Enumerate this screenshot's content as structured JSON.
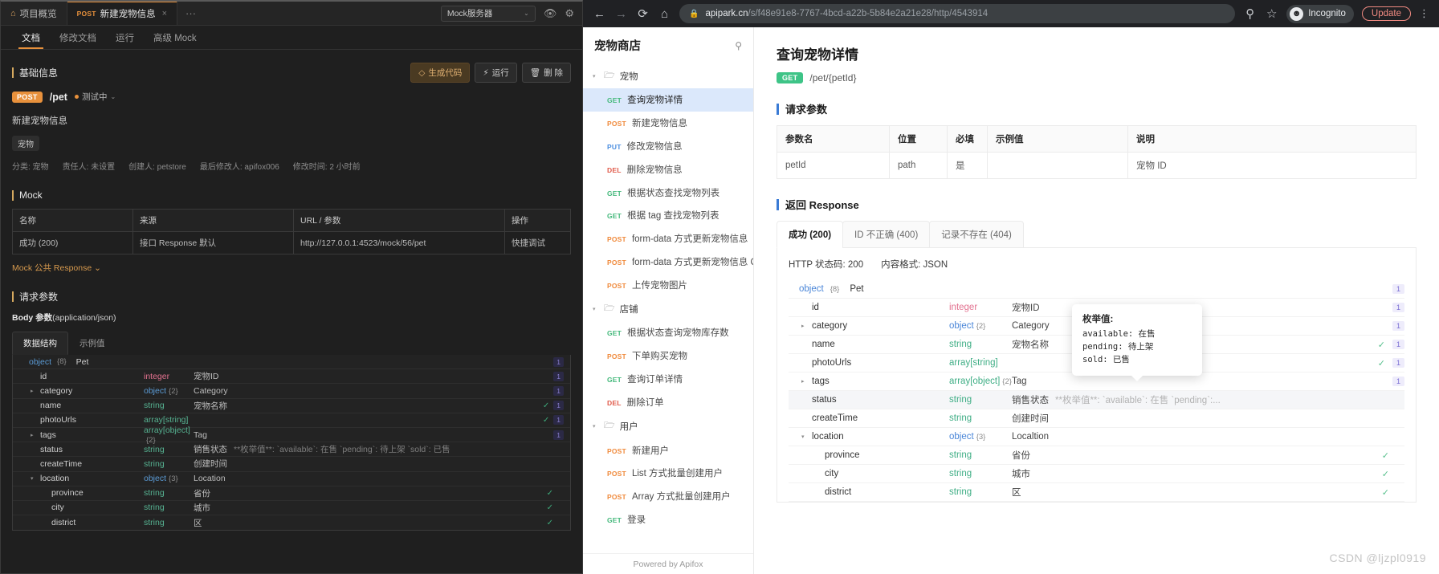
{
  "app": {
    "tabs": [
      {
        "icon": "project-icon",
        "label": "项目概览",
        "method": "",
        "active": false
      },
      {
        "icon": "",
        "label": "新建宠物信息",
        "method": "POST",
        "active": true,
        "close": "×"
      }
    ],
    "more": "···",
    "mock_server": {
      "label": "Mock服务器",
      "chevron": "⌄"
    },
    "header_icons": [
      "eye-icon",
      "gear-icon"
    ],
    "sub_tabs": [
      {
        "label": "文档",
        "active": true
      },
      {
        "label": "修改文档",
        "active": false
      },
      {
        "label": "运行",
        "active": false
      },
      {
        "label": "高级 Mock",
        "active": false
      }
    ],
    "basic": {
      "section": "基础信息",
      "actions": [
        {
          "label": "生成代码",
          "icon": "code-icon",
          "style": "gen"
        },
        {
          "label": "运行",
          "icon": "run-icon",
          "style": "run"
        },
        {
          "label": "删 除",
          "icon": "trash-icon",
          "style": "del"
        }
      ],
      "method": "POST",
      "path": "/pet",
      "status": "测试中",
      "status_chevron": "⌄",
      "api_name": "新建宠物信息",
      "tag": "宠物",
      "meta": [
        "分类: 宠物",
        "责任人: 未设置",
        "创建人: petstore",
        "最后修改人: apifox006",
        "修改时间: 2 小时前"
      ]
    },
    "mock": {
      "section": "Mock",
      "columns": [
        "名称",
        "来源",
        "URL / 参数",
        "操作"
      ],
      "rows": [
        {
          "name": "成功 (200)",
          "source": "接口 Response 默认",
          "url": "http://127.0.0.1:4523/mock/56/pet",
          "action": "快捷调试"
        }
      ],
      "public_link": "Mock 公共 Response ⌄"
    },
    "request": {
      "section": "请求参数",
      "body_label": "Body 参数",
      "body_type": "(application/json)",
      "tabs": [
        {
          "label": "数据结构",
          "active": true
        },
        {
          "label": "示例值",
          "active": false
        }
      ],
      "schema": [
        {
          "indent": 0,
          "arrow": "",
          "name": "object",
          "is_type_name": true,
          "count": "{8}",
          "type": "",
          "ref": "Pet",
          "desc": "",
          "check": false,
          "idx": "1"
        },
        {
          "indent": 1,
          "arrow": "",
          "name": "id",
          "type": "integer",
          "tclass": "t-int",
          "count": "",
          "desc": "宠物ID",
          "check": false,
          "idx": "1"
        },
        {
          "indent": 1,
          "arrow": "▸",
          "name": "category",
          "type": "object",
          "tclass": "t-obj",
          "count": "{2}",
          "desc": "Category",
          "check": false,
          "idx": "1"
        },
        {
          "indent": 1,
          "arrow": "",
          "name": "name",
          "type": "string",
          "tclass": "t-str",
          "count": "",
          "desc": "宠物名称",
          "check": true,
          "idx": "1"
        },
        {
          "indent": 1,
          "arrow": "",
          "name": "photoUrls",
          "type": "array[string]",
          "tclass": "t-str",
          "count": "",
          "desc": "",
          "check": true,
          "idx": "1"
        },
        {
          "indent": 1,
          "arrow": "▸",
          "name": "tags",
          "type": "array[object]",
          "tclass": "t-str",
          "count": "{2}",
          "desc": "Tag",
          "check": false,
          "idx": "1"
        },
        {
          "indent": 1,
          "arrow": "",
          "name": "status",
          "type": "string",
          "tclass": "t-str",
          "count": "",
          "desc": "销售状态",
          "enum": "**枚举值**: `available`: 在售 `pending`: 待上架 `sold`: 已售",
          "check": false,
          "idx": ""
        },
        {
          "indent": 1,
          "arrow": "",
          "name": "createTime",
          "type": "string",
          "tclass": "t-str",
          "count": "",
          "desc": "创建时间",
          "check": false,
          "idx": ""
        },
        {
          "indent": 1,
          "arrow": "▾",
          "name": "location",
          "type": "object",
          "tclass": "t-obj",
          "count": "{3}",
          "desc": "Location",
          "check": false,
          "idx": ""
        },
        {
          "indent": 2,
          "arrow": "",
          "name": "province",
          "type": "string",
          "tclass": "t-str",
          "count": "",
          "desc": "省份",
          "check": true,
          "idx": ""
        },
        {
          "indent": 2,
          "arrow": "",
          "name": "city",
          "type": "string",
          "tclass": "t-str",
          "count": "",
          "desc": "城市",
          "check": true,
          "idx": ""
        },
        {
          "indent": 2,
          "arrow": "",
          "name": "district",
          "type": "string",
          "tclass": "t-str",
          "count": "",
          "desc": "区",
          "check": true,
          "idx": ""
        }
      ]
    }
  },
  "browser": {
    "back": "←",
    "forward": "→",
    "reload": "⟳",
    "home": "⌂",
    "lock": "🔒",
    "url_host": "apipark.cn",
    "url_path": "/s/f48e91e8-7767-4bcd-a22b-5b84e2a21e28/http/4543914",
    "zoom_icon": "search-icon",
    "star": "☆",
    "incognito": "Incognito",
    "update": "Update",
    "kebab": "⋮"
  },
  "web": {
    "sidebar": {
      "title": "宠物商店",
      "search_icon": "search-icon",
      "footer": "Powered by Apifox",
      "items": [
        {
          "kind": "group",
          "label": "宠物",
          "caret": "▾"
        },
        {
          "kind": "api",
          "method": "GET",
          "mclass": "m-get",
          "label": "查询宠物详情",
          "selected": true
        },
        {
          "kind": "api",
          "method": "POST",
          "mclass": "m-post",
          "label": "新建宠物信息",
          "selected": false
        },
        {
          "kind": "api",
          "method": "PUT",
          "mclass": "m-put",
          "label": "修改宠物信息",
          "selected": false
        },
        {
          "kind": "api",
          "method": "DEL",
          "mclass": "m-del",
          "label": "删除宠物信息",
          "selected": false
        },
        {
          "kind": "api",
          "method": "GET",
          "mclass": "m-get",
          "label": "根据状态查找宠物列表",
          "selected": false
        },
        {
          "kind": "api",
          "method": "GET",
          "mclass": "m-get",
          "label": "根据 tag 查找宠物列表",
          "selected": false
        },
        {
          "kind": "api",
          "method": "POST",
          "mclass": "m-post",
          "label": "form-data 方式更新宠物信息",
          "selected": false
        },
        {
          "kind": "api",
          "method": "POST",
          "mclass": "m-post",
          "label": "form-data 方式更新宠物信息 Co",
          "selected": false
        },
        {
          "kind": "api",
          "method": "POST",
          "mclass": "m-post",
          "label": "上传宠物图片",
          "selected": false
        },
        {
          "kind": "group",
          "label": "店铺",
          "caret": "▾"
        },
        {
          "kind": "api",
          "method": "GET",
          "mclass": "m-get",
          "label": "根据状态查询宠物库存数",
          "selected": false
        },
        {
          "kind": "api",
          "method": "POST",
          "mclass": "m-post",
          "label": "下单购买宠物",
          "selected": false
        },
        {
          "kind": "api",
          "method": "GET",
          "mclass": "m-get",
          "label": "查询订单详情",
          "selected": false
        },
        {
          "kind": "api",
          "method": "DEL",
          "mclass": "m-del",
          "label": "删除订单",
          "selected": false
        },
        {
          "kind": "group",
          "label": "用户",
          "caret": "▾"
        },
        {
          "kind": "api",
          "method": "POST",
          "mclass": "m-post",
          "label": "新建用户",
          "selected": false
        },
        {
          "kind": "api",
          "method": "POST",
          "mclass": "m-post",
          "label": "List 方式批量创建用户",
          "selected": false
        },
        {
          "kind": "api",
          "method": "POST",
          "mclass": "m-post",
          "label": "Array 方式批量创建用户",
          "selected": false
        },
        {
          "kind": "api",
          "method": "GET",
          "mclass": "m-get",
          "label": "登录",
          "selected": false
        }
      ]
    },
    "doc": {
      "title": "查询宠物详情",
      "method": "GET",
      "path": "/pet/{petId}",
      "request_section": "请求参数",
      "param_columns": [
        "参数名",
        "位置",
        "必填",
        "示例值",
        "说明"
      ],
      "param_rows": [
        {
          "name": "petId",
          "in": "path",
          "required": "是",
          "example": "",
          "desc": "宠物 ID"
        }
      ],
      "response_section": "返回 Response",
      "resp_tabs": [
        {
          "label": "成功 (200)",
          "active": true
        },
        {
          "label": "ID 不正确 (400)",
          "active": false
        },
        {
          "label": "记录不存在 (404)",
          "active": false
        }
      ],
      "http_status": "HTTP 状态码: 200",
      "content_type": "内容格式: JSON",
      "schema": [
        {
          "indent": 0,
          "arrow": "",
          "name": "object",
          "is_type_name": true,
          "count": "{8}",
          "type": "",
          "ref": "Pet",
          "desc": "",
          "check": false,
          "idx": "1"
        },
        {
          "indent": 1,
          "arrow": "",
          "name": "id",
          "type": "integer",
          "tclass": "w-int",
          "count": "",
          "desc": "宠物ID",
          "check": false,
          "idx": "1"
        },
        {
          "indent": 1,
          "arrow": "▸",
          "name": "category",
          "type": "object",
          "tclass": "w-obj",
          "count": "{2}",
          "desc": "Category",
          "check": false,
          "idx": "1"
        },
        {
          "indent": 1,
          "arrow": "",
          "name": "name",
          "type": "string",
          "tclass": "w-str",
          "count": "",
          "desc": "宠物名称",
          "check": true,
          "idx": "1"
        },
        {
          "indent": 1,
          "arrow": "",
          "name": "photoUrls",
          "type": "array[string]",
          "tclass": "w-str",
          "count": "",
          "desc": "",
          "check": true,
          "idx": "1"
        },
        {
          "indent": 1,
          "arrow": "▸",
          "name": "tags",
          "type": "array[object]",
          "tclass": "w-str",
          "count": "{2}",
          "desc": "Tag",
          "check": false,
          "idx": "1"
        },
        {
          "indent": 1,
          "arrow": "",
          "name": "status",
          "type": "string",
          "tclass": "w-str",
          "count": "",
          "desc": "销售状态",
          "enum": "**枚举值**: `available`: 在售 `pending`:...",
          "check": false,
          "idx": "",
          "highlight": true
        },
        {
          "indent": 1,
          "arrow": "",
          "name": "createTime",
          "type": "string",
          "tclass": "w-str",
          "count": "",
          "desc": "创建时间",
          "check": false,
          "idx": ""
        },
        {
          "indent": 1,
          "arrow": "▾",
          "name": "location",
          "type": "object",
          "tclass": "w-obj",
          "count": "{3}",
          "desc": "Localtion",
          "check": false,
          "idx": ""
        },
        {
          "indent": 2,
          "arrow": "",
          "name": "province",
          "type": "string",
          "tclass": "w-str",
          "count": "",
          "desc": "省份",
          "check": true,
          "idx": ""
        },
        {
          "indent": 2,
          "arrow": "",
          "name": "city",
          "type": "string",
          "tclass": "w-str",
          "count": "",
          "desc": "城市",
          "check": true,
          "idx": ""
        },
        {
          "indent": 2,
          "arrow": "",
          "name": "district",
          "type": "string",
          "tclass": "w-str",
          "count": "",
          "desc": "区",
          "check": true,
          "idx": ""
        }
      ],
      "tooltip": {
        "title": "枚举值:",
        "lines": [
          "available: 在售",
          "pending: 待上架",
          "sold: 已售"
        ]
      }
    }
  },
  "watermark": "CSDN @ljzpl0919"
}
